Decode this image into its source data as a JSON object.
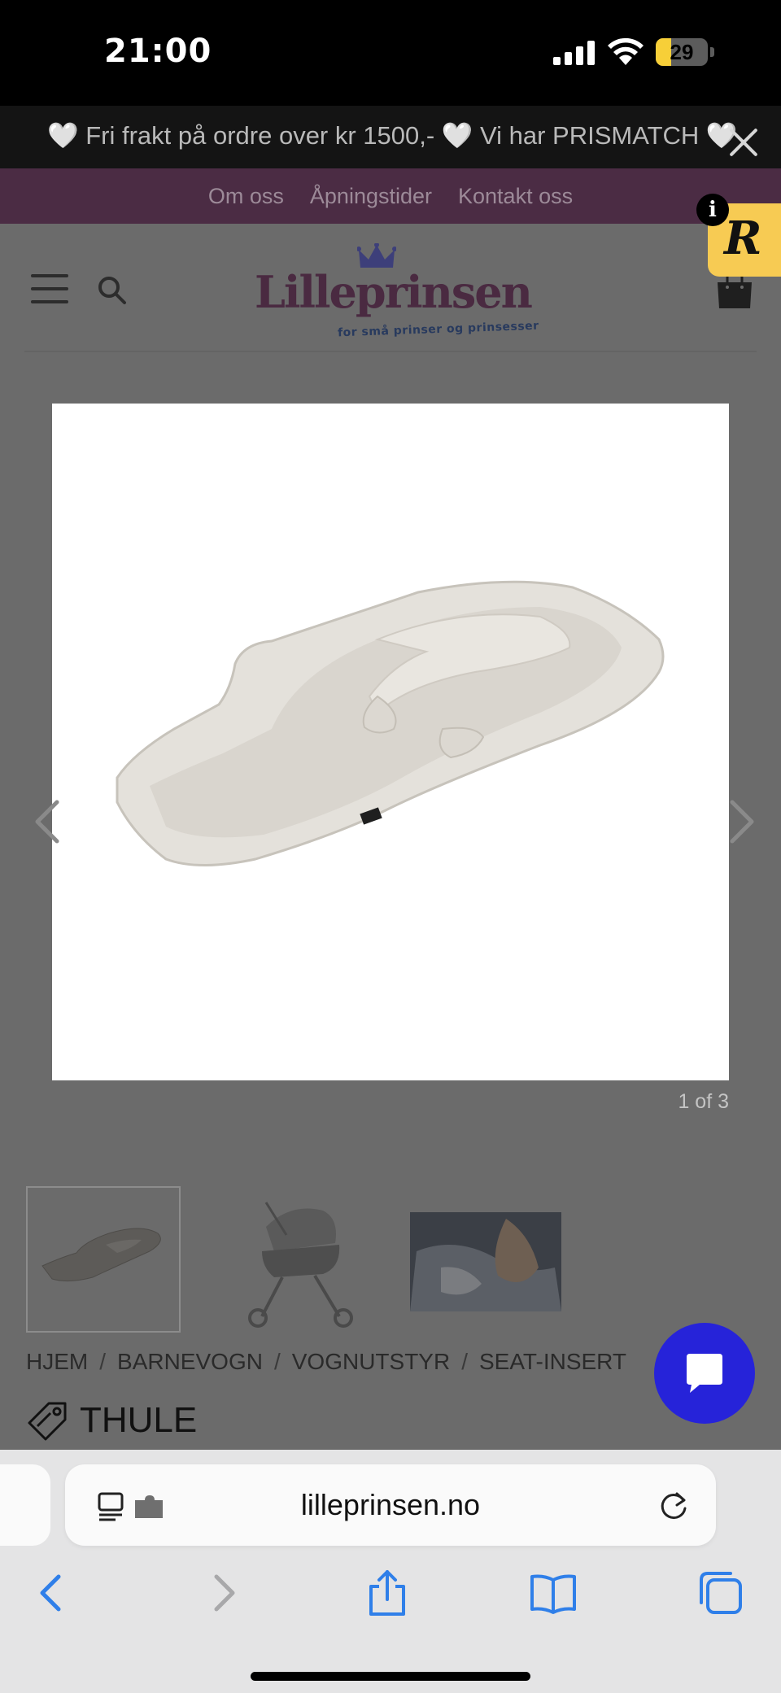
{
  "status_bar": {
    "time": "21:00",
    "battery_percent": "29",
    "battery_level": 0.29
  },
  "promo": {
    "text": "🤍 Fri frakt på ordre over kr 1500,- 🤍 Vi har PRISMATCH 🤍"
  },
  "top_nav": {
    "links": [
      "Om oss",
      "Åpningstider",
      "Kontakt oss"
    ]
  },
  "logo": {
    "name": "Lilleprinsen",
    "tagline": "for små prinser og prinsesser"
  },
  "review_badge": {
    "letter": "R",
    "info": "i"
  },
  "gallery": {
    "counter": "1 of 3",
    "total_images": 3,
    "current_index": 1
  },
  "breadcrumb": [
    "HJEM",
    "BARNEVOGN",
    "VOGNUTSTYR",
    "SEAT-INSERT"
  ],
  "brand": {
    "name": "THULE"
  },
  "safari": {
    "url": "lilleprinsen.no"
  },
  "icons": [
    "menu-icon",
    "search-icon",
    "bag-icon",
    "close-icon",
    "chevron-left-icon",
    "chevron-right-icon",
    "tag-icon",
    "chat-icon",
    "reader-icon",
    "reload-icon",
    "back-icon",
    "forward-icon",
    "share-icon",
    "bookmarks-icon",
    "tabs-icon"
  ],
  "colors": {
    "accent_purple": "#4b2c44",
    "chat_blue": "#2623d9",
    "review_yellow": "#f7cb53",
    "safari_blue": "#2f7fe9"
  }
}
